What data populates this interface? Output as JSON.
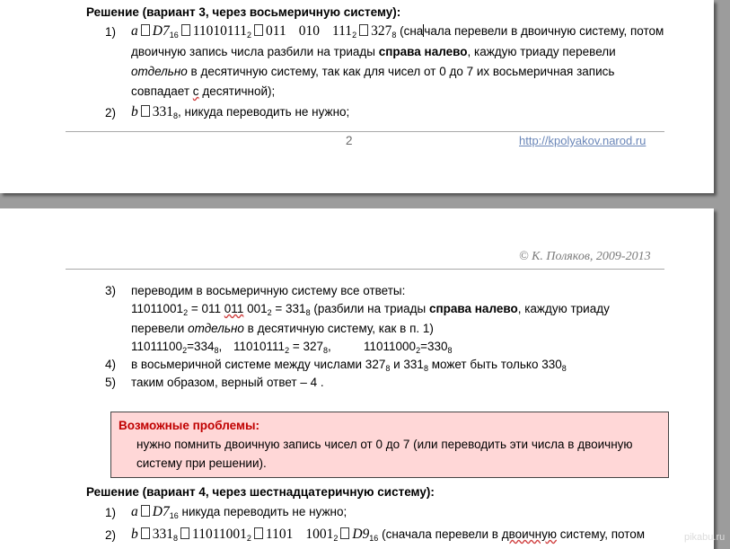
{
  "page1": {
    "heading": "Решение (вариант 3, через восьмеричную систему):",
    "item1": {
      "num": "1)",
      "var": "a",
      "hex": "D7",
      "hex_base": "16",
      "bin": "11010111",
      "bin_base": "2",
      "triads": [
        "011",
        "010",
        "111"
      ],
      "triads_base": "2",
      "oct": "327",
      "oct_base": "8",
      "note_before_cursor": "(сна",
      "note_after_cursor": "чала перевели в двоичную систему, потом",
      "line2": "двоичную запись числа разбили на триады",
      "line2_bold": "справа налево",
      "line2_tail": ", каждую триаду перевели",
      "line3_italic": "отдельно",
      "line3_tail": " в десятичную систему, так как для чисел от 0 до 7 их восьмеричная запись",
      "line4_a": "совпадает",
      "line4_b": "с",
      "line4_c": "десятичной);"
    },
    "item2": {
      "num": "2)",
      "var": "b",
      "oct": "331",
      "oct_base": "8",
      "text": ", никуда переводить не нужно;"
    },
    "footer": {
      "page_number": "2",
      "link": "http://kpolyakov.narod.ru"
    }
  },
  "page2": {
    "header_text": "© К. Поляков, 2009-2013",
    "item3": {
      "num": "3)",
      "text": "переводим в восьмеричную систему все ответы:",
      "row1_bin": "11011001",
      "row1_base": "2",
      "row1_eq": "= 011",
      "row1_t2": "011",
      "row1_t3": "001",
      "row1_t3_base": "2",
      "row1_res": "= 331",
      "row1_res_base": "8",
      "row1_note": "(разбили на триады",
      "row1_bold": "справа налево",
      "row1_tail": ", каждую триаду",
      "row2_a": "перевели",
      "row2_italic": "отдельно",
      "row2_tail": "в десятичную систему, как в п. 1)",
      "conv1_bin": "11011100",
      "conv1_base": "2",
      "conv1_res": "=334",
      "conv1_res_base": "8",
      "conv1_sep": ",",
      "conv2_bin": "11010111",
      "conv2_base": "2",
      "conv2_res": " = 327",
      "conv2_res_base": "8",
      "conv2_sep": ",",
      "conv3_bin": "11011000",
      "conv3_base": "2",
      "conv3_res": "=330",
      "conv3_res_base": "8"
    },
    "item4": {
      "num": "4)",
      "text": "в восьмеричной системе между числами 327",
      "base1": "8",
      "mid": " и 331",
      "base2": "8",
      "mid2": "  может быть только 330",
      "base3": "8"
    },
    "item5": {
      "num": "5)",
      "text": "таким образом, верный ответ – 4  ."
    },
    "problems": {
      "title": "Возможные проблемы:",
      "line1": "нужно помнить двоичную запись чисел от 0 до 7 (или переводить эти числа в двоичную",
      "line2": "систему при решении)."
    },
    "heading4": "Решение (вариант 4, через шестнадцатеричную систему):",
    "v4_item1": {
      "num": "1)",
      "var": "a",
      "hex": "D7",
      "hex_base": "16",
      "text": "никуда переводить не нужно;"
    },
    "v4_item2": {
      "num": "2)",
      "var": "b",
      "oct": "331",
      "oct_base": "8",
      "bin": "11011001",
      "bin_base": "2",
      "t1": "1101",
      "t2": "1001",
      "t_base": "2",
      "hex": "D9",
      "hex_base": "16",
      "note_a": "(сначала перевели в",
      "note_b": "двоичную",
      "note_c": "систему, потом"
    }
  },
  "watermark": "pikabu.ru"
}
